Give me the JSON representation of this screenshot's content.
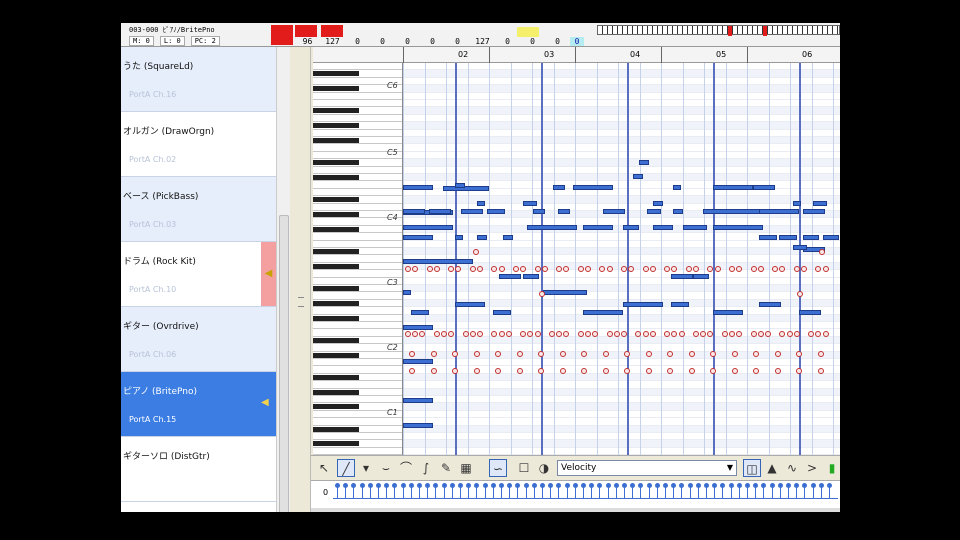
{
  "header": {
    "title": "003-000 ﾋﾟｱﾉ/BritePno",
    "params": [
      "M: 0",
      "L: 0",
      "PC: 2"
    ],
    "meters": [
      "96",
      "127",
      "0",
      "0",
      "0",
      "0",
      "0",
      "127",
      "0",
      "0",
      "0"
    ],
    "meter_last": "0"
  },
  "tracks": [
    {
      "name": "うた (SquareLd)",
      "port": "PortA Ch.16"
    },
    {
      "name": "オルガン (DrawOrgn)",
      "port": "PortA Ch.02"
    },
    {
      "name": "ベース (PickBass)",
      "port": "PortA Ch.03"
    },
    {
      "name": "ドラム (Rock Kit)",
      "port": "PortA Ch.10"
    },
    {
      "name": "ギター (Ovrdrive)",
      "port": "PortA Ch.06"
    },
    {
      "name": "ピアノ (BritePno)",
      "port": "PortA Ch.15"
    },
    {
      "name": "ギターソロ (DistGtr)",
      "port": ""
    }
  ],
  "ruler": {
    "measures": [
      "02",
      "03",
      "04",
      "05",
      "06"
    ]
  },
  "keyboard": {
    "octaves": [
      "C6",
      "C5",
      "C4",
      "C3",
      "C2",
      "C1"
    ]
  },
  "toolbar": {
    "controller": "Velocity"
  },
  "velocity": {
    "zero_label": "0"
  },
  "colors": {
    "note": "#3d6ed1",
    "drum": "#c03030",
    "selected_track": "#3b7de3",
    "meter_red": "#e21b1b"
  }
}
